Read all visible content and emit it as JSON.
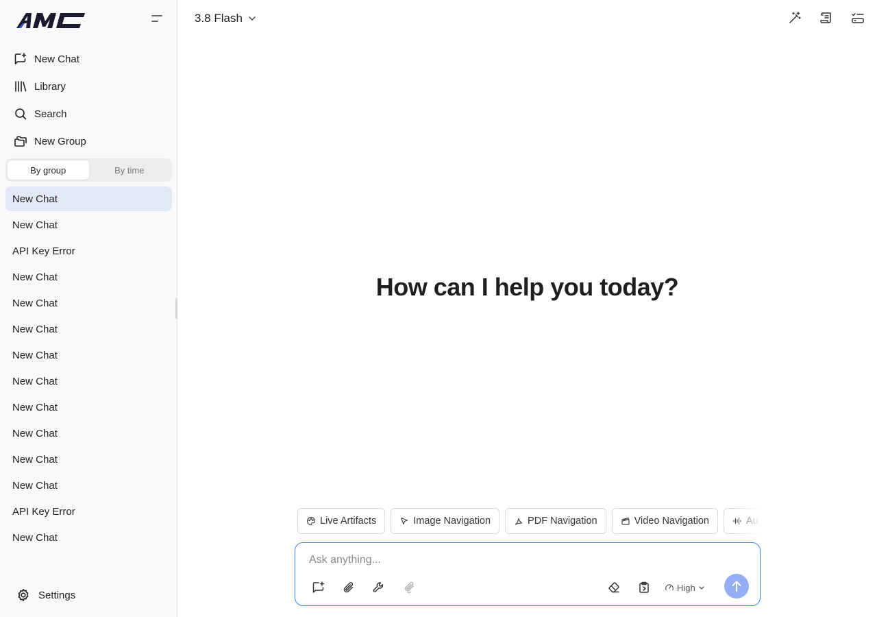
{
  "app": {
    "logo_text": "AMC"
  },
  "sidebar": {
    "nav": [
      {
        "label": "New Chat",
        "icon": "new-chat-icon"
      },
      {
        "label": "Library",
        "icon": "library-icon"
      },
      {
        "label": "Search",
        "icon": "search-icon"
      },
      {
        "label": "New Group",
        "icon": "folder-icon"
      }
    ],
    "view_toggle": {
      "by_group": "By group",
      "by_time": "By time",
      "active": "By group"
    },
    "chats": [
      "New Chat",
      "New Chat",
      "API Key Error",
      "New Chat",
      "New Chat",
      "New Chat",
      "New Chat",
      "New Chat",
      "New Chat",
      "New Chat",
      "New Chat",
      "New Chat",
      "API Key Error",
      "New Chat"
    ],
    "settings_label": "Settings"
  },
  "header": {
    "model": "3.8 Flash"
  },
  "main": {
    "greeting": "How can I help you today?"
  },
  "chips": [
    {
      "label": "Live Artifacts",
      "icon": "palette-icon"
    },
    {
      "label": "Image Navigation",
      "icon": "cursor-icon"
    },
    {
      "label": "PDF Navigation",
      "icon": "pdf-icon"
    },
    {
      "label": "Video Navigation",
      "icon": "video-icon"
    },
    {
      "label": "Au",
      "icon": "audio-wave-icon"
    }
  ],
  "composer": {
    "placeholder": "Ask anything...",
    "effort": "High"
  },
  "colors": {
    "accent": "#3b82f6",
    "active_chat_bg": "#e3e8f6",
    "send_button": "#93aef5",
    "logo_blue": "#2e5bd9"
  }
}
